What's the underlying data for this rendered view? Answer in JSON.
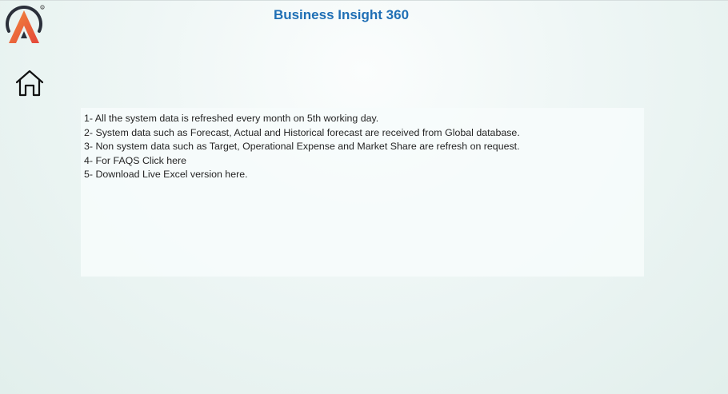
{
  "header": {
    "title": "Business Insight 360"
  },
  "icons": {
    "logo": "brand-logo-icon",
    "home": "home-icon"
  },
  "colors": {
    "title": "#1f6fb5",
    "logo_orange": "#f06a35",
    "logo_dark": "#2a2f3a"
  },
  "info": {
    "lines": [
      "1- All the system data is refreshed every month on 5th working day.",
      "2- System data such as Forecast, Actual and Historical forecast are received from Global database.",
      "3- Non system data such as Target, Operational Expense and Market Share are refresh on request.",
      "4- For FAQS Click here",
      "5- Download Live Excel version here."
    ]
  }
}
